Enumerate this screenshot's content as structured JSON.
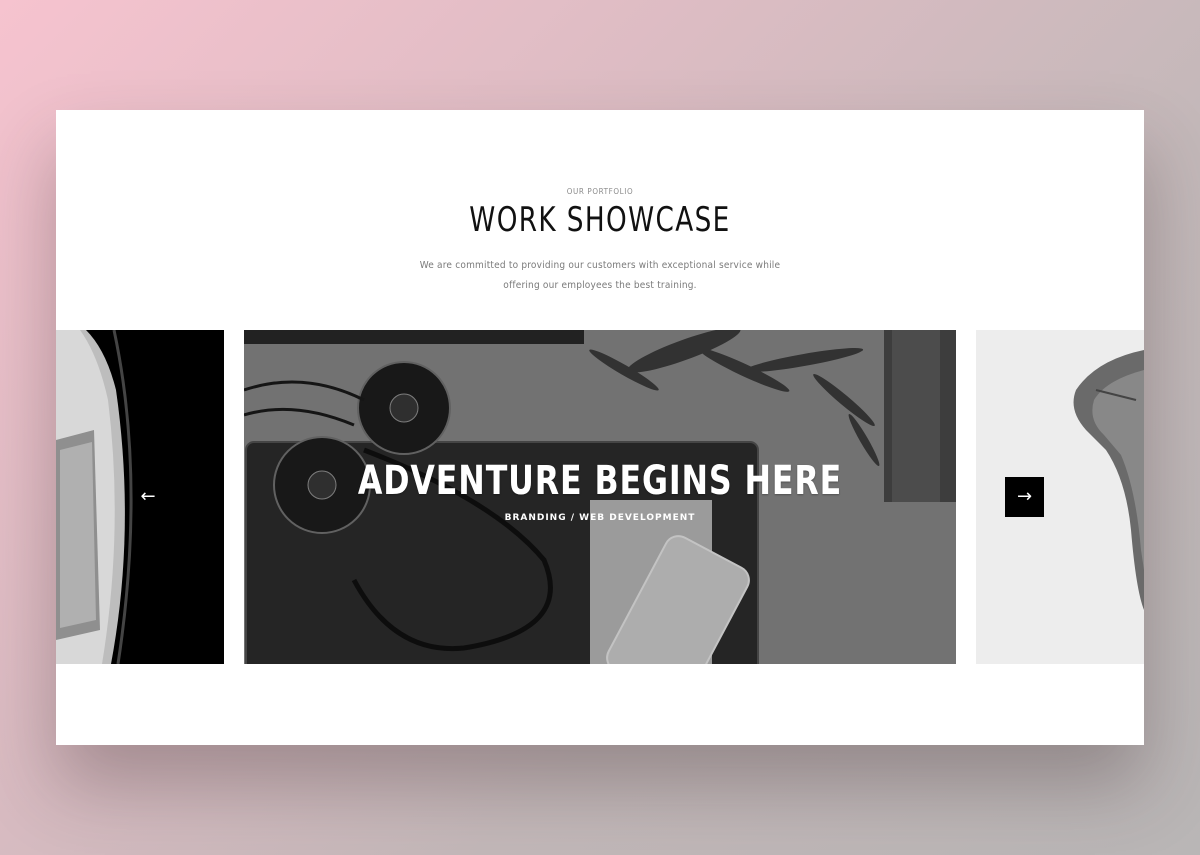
{
  "section": {
    "eyebrow": "OUR PORTFOLIO",
    "title": "WORK SHOWCASE",
    "description": "We are committed to providing our customers with exceptional service while offering our employees the best training."
  },
  "slider": {
    "prev_icon": "←",
    "next_icon": "→",
    "active_slide": {
      "title": "ADVENTURE BEGINS HERE",
      "tags": "BRANDING / WEB DEVELOPMENT"
    }
  },
  "colors": {
    "accent": "#000000",
    "text_dark": "#111111",
    "text_muted": "#7a7a7a"
  }
}
